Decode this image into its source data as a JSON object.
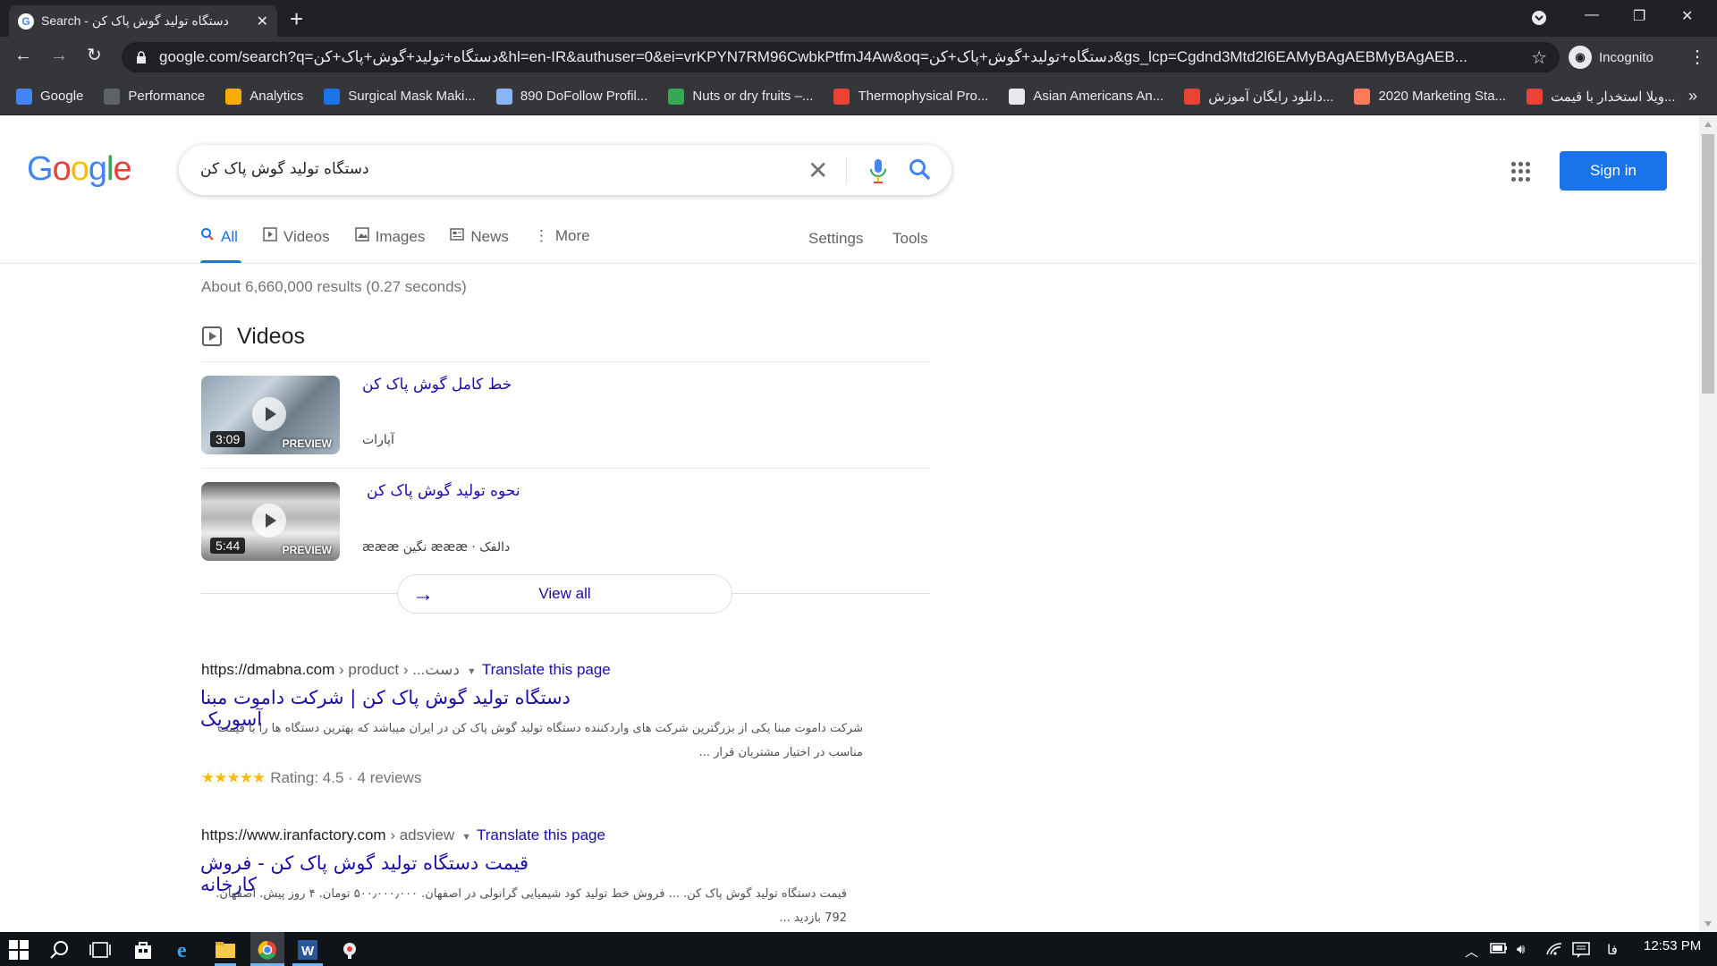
{
  "browser": {
    "tab_title": "Search - دستگاه تولید گوش پاک کن",
    "url": "google.com/search?q=دستگاه+تولید+گوش+پاک+کن&hl=en-IR&authuser=0&ei=vrKPYN7RM96CwbkPtfmJ4Aw&oq=دستگاه+تولید+گوش+پاک+کن&gs_lcp=Cgdnd3Mtd2l6EAMyBAgAEBMyBAgAEB...",
    "incognito_label": "Incognito"
  },
  "bookmarks": [
    {
      "label": "Google",
      "color": "#4285f4"
    },
    {
      "label": "Performance",
      "color": "#5f6368"
    },
    {
      "label": "Analytics",
      "color": "#f9ab00"
    },
    {
      "label": "Surgical Mask Maki...",
      "color": "#1a73e8"
    },
    {
      "label": "890 DoFollow Profil...",
      "color": "#8ab4f8"
    },
    {
      "label": "Nuts or dry fruits –...",
      "color": "#34a853"
    },
    {
      "label": "Thermophysical Pro...",
      "color": "#ea4335"
    },
    {
      "label": "Asian Americans An...",
      "color": "#e8eaed"
    },
    {
      "label": "دانلود رایگان آموزش...",
      "color": "#ea4335"
    },
    {
      "label": "2020 Marketing Sta...",
      "color": "#ff7a59"
    },
    {
      "label": "ویلا استخدار با قیمت...",
      "color": "#ea4335"
    }
  ],
  "bookmarks_more": "»",
  "google": {
    "logo": [
      "G",
      "o",
      "o",
      "g",
      "l",
      "e"
    ],
    "query": "دستگاه تولید گوش پاک کن",
    "sign_in": "Sign in"
  },
  "tabs": {
    "all": "All",
    "videos": "Videos",
    "images": "Images",
    "news": "News",
    "more": "More",
    "settings": "Settings",
    "tools": "Tools"
  },
  "stats": "About 6,660,000 results (0.27 seconds)",
  "videos": {
    "heading": "Videos",
    "items": [
      {
        "title": "خط کامل گوش پاک کن",
        "source": "آپارات",
        "duration": "3:09",
        "preview": "PREVIEW"
      },
      {
        "title": "نحوه تولید گوش پاک کن",
        "source": "دالفک · æææ نگین æææ",
        "duration": "5:44",
        "preview": "PREVIEW"
      }
    ],
    "view_all": "View all"
  },
  "results": [
    {
      "domain": "https://dmabna.com",
      "path": " › product › ...دست",
      "translate": "Translate this page",
      "title": "دستگاه تولید گوش پاک کن | شرکت داموت مبنا آسوریک",
      "snippet": "شرکت داموت مبنا یکی از بزرگترین شرکت های واردکننده دستگاه تولید گوش پاک کن در ایران میباشد که بهترین دستگاه ها را با قیمت مناسب در اختیار مشتریان قرار ...",
      "stars": "★★★★★",
      "rating": "Rating: 4.5 · 4 reviews"
    },
    {
      "domain": "https://www.iranfactory.com",
      "path": " › adsview",
      "translate": "Translate this page",
      "title": "قیمت دستگاه تولید گوش پاک کن - فروش کارخانه",
      "snippet": "قیمت دستگاه تولید گوش پاک کن. ... فروش خط تولید کود شیمیایی گرانولی در اصفهان. ۵۰۰٫۰۰۰٫۰۰۰ تومان. ۴ روز پیش. اصفهان. 792 بازدید ..."
    }
  ],
  "taskbar": {
    "language": "فا",
    "time": "12:53 PM"
  }
}
